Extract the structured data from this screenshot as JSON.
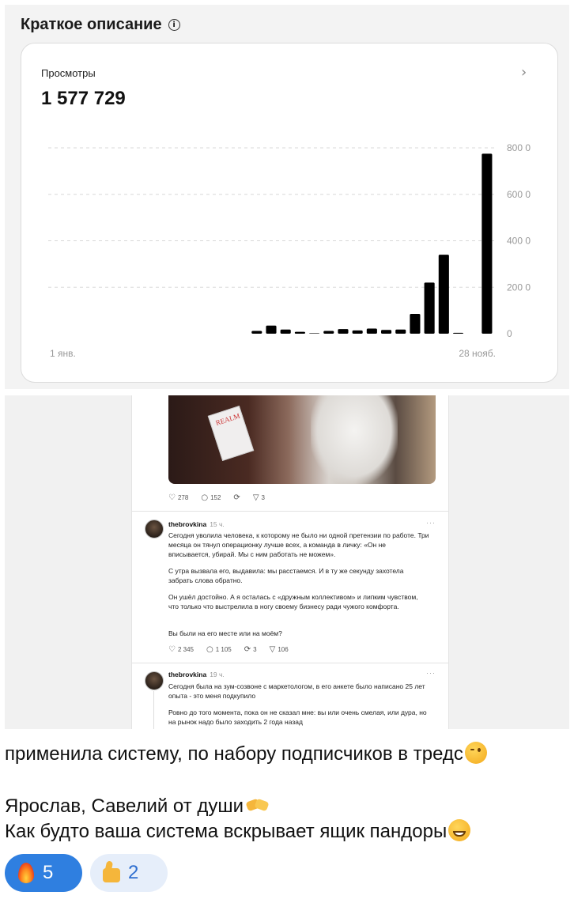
{
  "analytics": {
    "section_title": "Краткое описание",
    "card_label": "Просмотры",
    "card_value": "1 577 729",
    "x_start_label": "1 янв.",
    "x_end_label": "28 нояб."
  },
  "chart_data": {
    "type": "bar",
    "title": "",
    "xlabel": "",
    "ylabel": "",
    "ylim": [
      0,
      800
    ],
    "yticks": [
      "0",
      "200 0",
      "400 0",
      "600 0",
      "800 0"
    ],
    "x_labels": [
      "1 янв.",
      "28 нояб."
    ],
    "grid": true,
    "values": [
      0,
      0,
      0,
      0,
      0,
      0,
      0,
      0,
      0,
      0,
      0,
      0,
      0,
      0,
      12,
      35,
      18,
      8,
      2,
      12,
      20,
      14,
      22,
      16,
      18,
      85,
      220,
      340,
      4,
      0,
      775
    ]
  },
  "posts": [
    {
      "likes": "278",
      "replies": "152",
      "reposts": "",
      "shares": "3"
    },
    {
      "username": "thebrovkina",
      "time": "15 ч.",
      "paragraphs": [
        "Сегодня уволила человека, к которому не было ни одной претензии по работе. Три месяца он тянул операционку лучше всех, а команда в личку: «Он не вписывается, убирай. Мы с ним работать не можем».",
        "С утра вызвала его, выдавила: мы расстаемся. И в ту же секунду захотела забрать слова обратно.",
        "Он ушёл достойно. А я осталась с «дружным коллективом» и липким чувством, что только что выстрелила в ногу своему бизнесу ради чужого комфорта.",
        "Вы были на его месте или на моём?"
      ],
      "likes": "2 345",
      "replies": "1 105",
      "reposts": "3",
      "shares": "106"
    },
    {
      "username": "thebrovkina",
      "time": "19 ч.",
      "paragraphs": [
        "Сегодня была на зум-созвоне с маркетологом, в его анкете было написано 25 лет опыта - это меня подкупило",
        "Ровно до того момента, пока он не сказал мне: вы или очень смелая, или дура, но на рынок надо было заходить 2 года назад"
      ]
    }
  ],
  "image_book_text": "REALM",
  "message": {
    "line1": "применила систему, по набору подписчиков в тредс",
    "line2": "Ярослав, Савелий от души",
    "line3": "Как будто ваша система вскрывает ящик пандоры"
  },
  "reactions": [
    {
      "icon": "fire-icon",
      "count": "5"
    },
    {
      "icon": "thumbs-up-icon",
      "count": "2"
    }
  ],
  "colors": {
    "reaction_active": "#2f7fe0",
    "reaction_inactive": "#e6eefa",
    "bars": "#000000"
  }
}
